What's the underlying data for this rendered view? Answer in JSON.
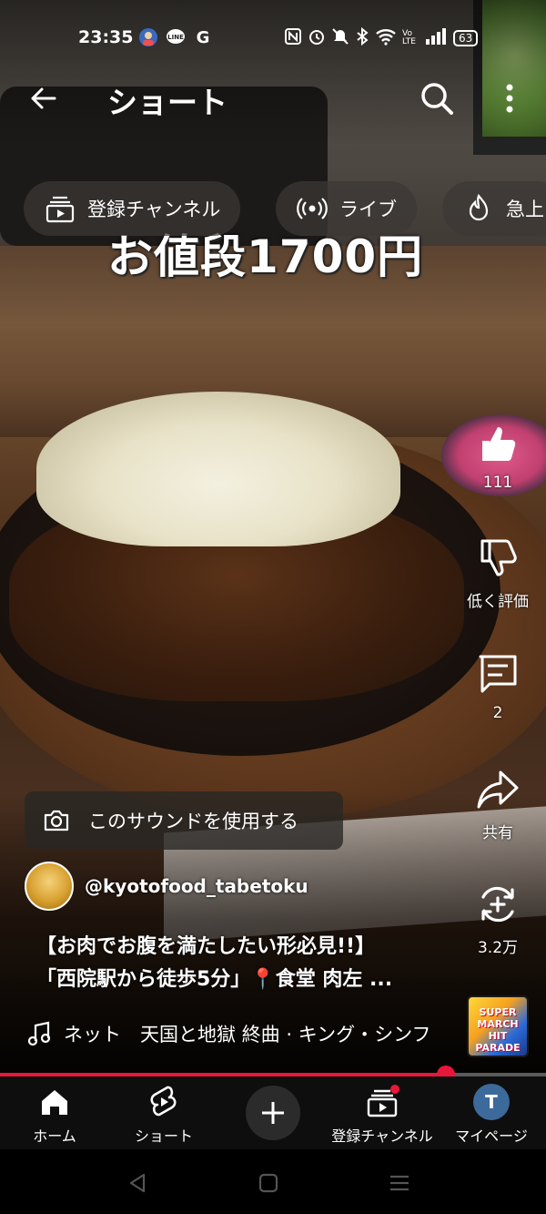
{
  "status_bar": {
    "time": "23:35",
    "left_icons": [
      "avatar-notification-icon",
      "line-icon",
      "google-icon"
    ],
    "right_icons": [
      "nfc-icon",
      "alarm-icon",
      "mute-icon",
      "bluetooth-icon",
      "wifi-icon",
      "volte-icon",
      "signal-icon"
    ],
    "volte": "Vo LTE",
    "battery": "63"
  },
  "app_bar": {
    "title": "ショート"
  },
  "chips": [
    {
      "label": "登録チャンネル",
      "icon": "subscriptions-icon"
    },
    {
      "label": "ライブ",
      "icon": "live-icon"
    },
    {
      "label": "急上",
      "icon": "trending-icon"
    }
  ],
  "video": {
    "price_caption": "お値段1700円",
    "use_sound_label": "このサウンドを使用する",
    "channel_handle": "@kyotofood_tabetoku",
    "description_line1": "【お肉でお腹を満たしたい形必見!!】",
    "description_line2": "「西院駅から徒歩5分」📍食堂 肉左 ...",
    "music_text": "ネット　天国と地獄 終曲 · キング・シンフ",
    "album_art_text": "SUPER MARCH HIT PARADE",
    "progress": 0.817
  },
  "actions": {
    "like_count": "111",
    "dislike_label": "低く評価",
    "comment_count": "2",
    "share_label": "共有",
    "remix_count": "3.2万"
  },
  "bottom_nav": {
    "home": "ホーム",
    "shorts": "ショート",
    "subscriptions": "登録チャンネル",
    "you": "マイページ",
    "you_initial": "T"
  },
  "colors": {
    "accent_red": "#e8173a",
    "nav_bg": "#0e0e0e"
  }
}
